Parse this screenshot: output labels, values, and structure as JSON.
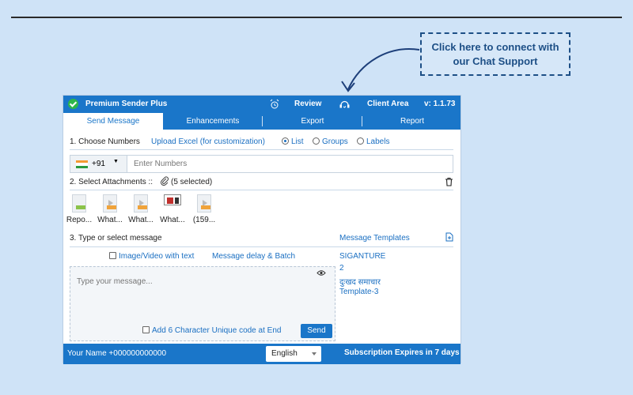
{
  "callout": {
    "line1": "Click here to connect with",
    "line2": "our Chat Support"
  },
  "titlebar": {
    "app_name": "Premium Sender Plus",
    "review": "Review",
    "client_area": "Client Area",
    "version": "v: 1.1.73"
  },
  "tabs": [
    "Send Message",
    "Enhancements",
    "Export",
    "Report"
  ],
  "section1": {
    "label": "1. Choose Numbers",
    "upload_link": "Upload Excel (for customization)",
    "options": [
      "List",
      "Groups",
      "Labels"
    ],
    "selected": "List"
  },
  "phone": {
    "country_code": "+91",
    "placeholder": "Enter Numbers"
  },
  "section2": {
    "label": "2. Select Attachments ::",
    "selected_count": "(5 selected)"
  },
  "attachments": [
    {
      "name": "Repo...",
      "kind": "xls"
    },
    {
      "name": "What...",
      "kind": "mp4"
    },
    {
      "name": "What...",
      "kind": "mp4"
    },
    {
      "name": "What...",
      "kind": "image"
    },
    {
      "name": "(159...",
      "kind": "mp4"
    }
  ],
  "section3": {
    "label": "3. Type or select message",
    "templates_label": "Message Templates"
  },
  "options_row": {
    "image_video": "Image/Video with text",
    "delay": "Message delay & Batch"
  },
  "templates": [
    "SIGANTURE",
    "2",
    "दुःखद समाचार",
    "Template-3"
  ],
  "message": {
    "placeholder": "Type your message...",
    "unique_code": "Add 6 Character Unique code at End",
    "send": "Send"
  },
  "footer": {
    "user": "Your Name +000000000000",
    "language": "English",
    "subscription": "Subscription Expires in 7 days"
  },
  "colors": {
    "primary": "#1a76c9",
    "background": "#cfe3f7",
    "callout_text": "#1d4f86"
  }
}
